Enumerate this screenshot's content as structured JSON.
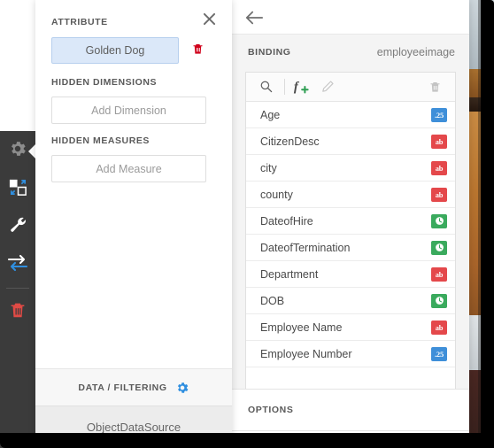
{
  "icon_rail": {
    "items": [
      {
        "name": "gear-icon",
        "label": "Settings",
        "state": "active"
      },
      {
        "name": "layout-icon",
        "label": "Layout",
        "state": "default"
      },
      {
        "name": "wrench-icon",
        "label": "Tools",
        "state": "default"
      },
      {
        "name": "swap-arrows-icon",
        "label": "Swap",
        "state": "default"
      },
      {
        "name": "trash-icon",
        "label": "Delete",
        "state": "danger"
      }
    ]
  },
  "attribute_panel": {
    "close_label": "✕",
    "attribute_heading": "ATTRIBUTE",
    "attribute_chip": "Golden Dog",
    "delete_icon": "trash-icon",
    "hidden_dimensions_heading": "HIDDEN DIMENSIONS",
    "add_dimension_label": "Add Dimension",
    "hidden_measures_heading": "HIDDEN MEASURES",
    "add_measure_label": "Add Measure",
    "data_filtering_label": "DATA / FILTERING",
    "data_filtering_icon": "gear-icon",
    "datasource_label": "ObjectDataSource"
  },
  "binding_panel": {
    "back_icon": "back-arrow-icon",
    "binding_label": "BINDING",
    "binding_value": "employeeimage",
    "toolbar": [
      {
        "name": "search-icon",
        "label": "Search",
        "enabled": true
      },
      {
        "name": "add-function-icon",
        "label": "Add Expression",
        "enabled": true
      },
      {
        "name": "edit-pencil-icon",
        "label": "Edit",
        "enabled": false
      },
      {
        "name": "delete-trash-icon",
        "label": "Delete",
        "enabled": false
      }
    ],
    "fields": [
      {
        "name": "Age",
        "type": "number",
        "badge": ".25"
      },
      {
        "name": "CitizenDesc",
        "type": "text",
        "badge": "ab"
      },
      {
        "name": "city",
        "type": "text",
        "badge": "ab"
      },
      {
        "name": "county",
        "type": "text",
        "badge": "ab"
      },
      {
        "name": "DateofHire",
        "type": "date",
        "badge": "clock"
      },
      {
        "name": "DateofTermination",
        "type": "date",
        "badge": "clock"
      },
      {
        "name": "Department",
        "type": "text",
        "badge": "ab"
      },
      {
        "name": "DOB",
        "type": "date",
        "badge": "clock"
      },
      {
        "name": "Employee Name",
        "type": "text",
        "badge": "ab"
      },
      {
        "name": "Employee Number",
        "type": "number",
        "badge": ".25"
      }
    ],
    "options_label": "OPTIONS"
  },
  "colors": {
    "accent_blue": "#3f8fd9",
    "text_red": "#e4484b",
    "date_green": "#3aaa5d",
    "chip_bg": "#dbe8f9",
    "chip_border": "#b7cfee",
    "rail_bg": "#3b3b3b",
    "panel_bg": "#f4f4f4"
  }
}
